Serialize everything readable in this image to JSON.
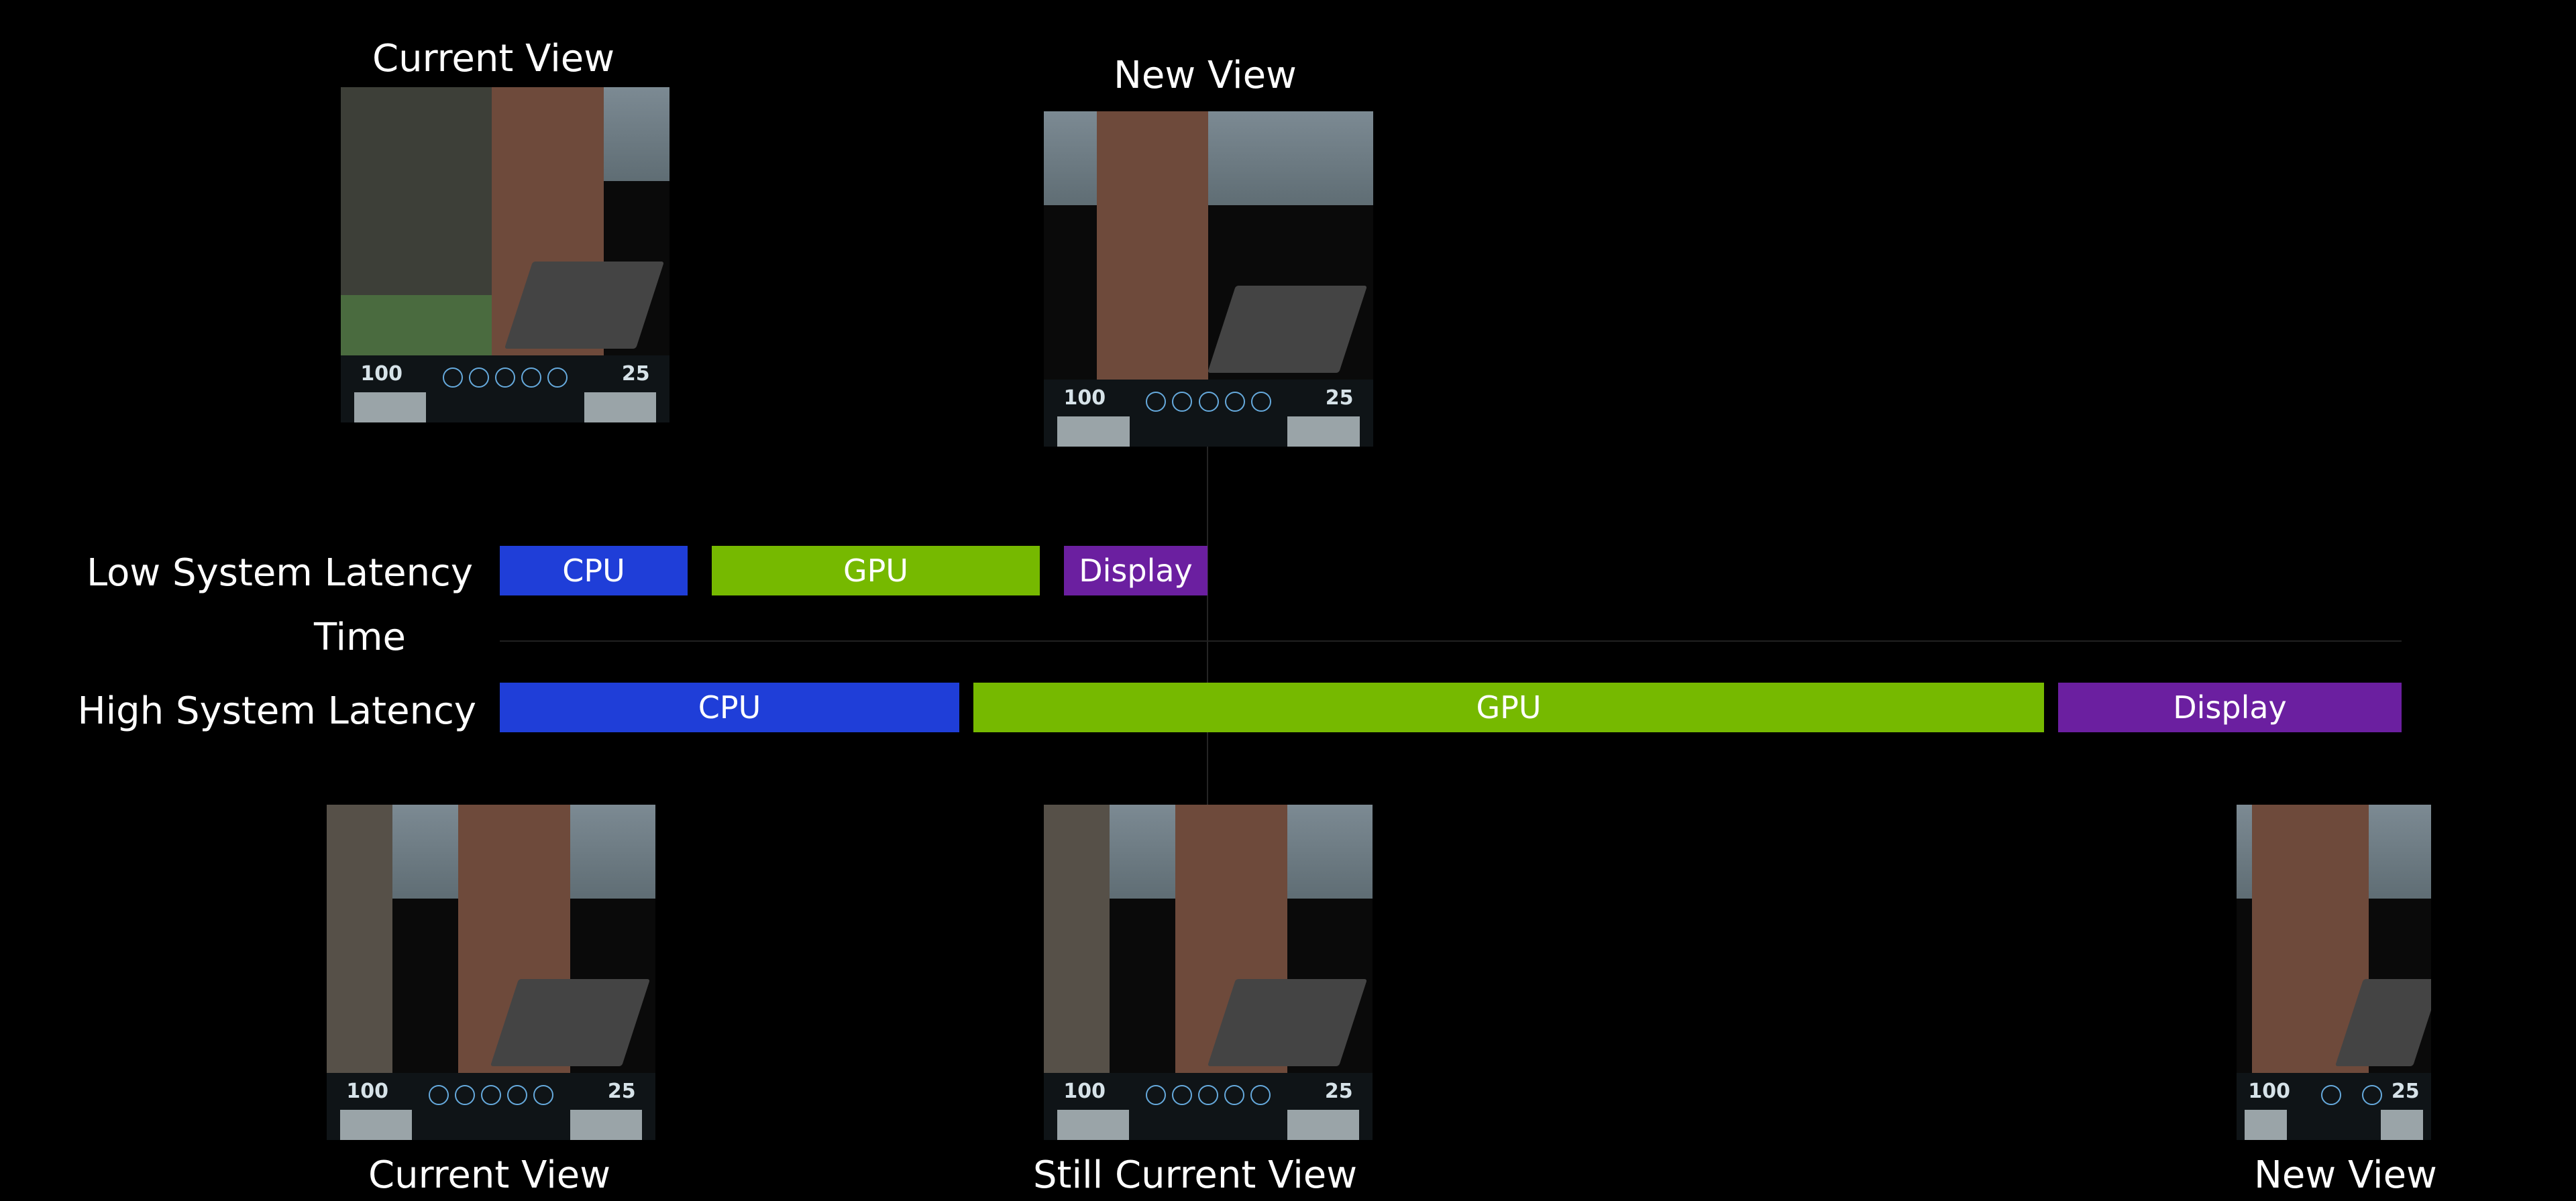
{
  "labels": {
    "currentViewTop": "Current View",
    "newViewTop": "New View",
    "lowLatency": "Low System Latency",
    "highLatency": "High System Latency",
    "time": "Time",
    "currentViewBottom": "Current View",
    "stillCurrentView": "Still Current View",
    "newViewBottom": "New View"
  },
  "stages": {
    "cpu": "CPU",
    "gpu": "GPU",
    "display": "Display"
  },
  "hud": {
    "hp": "100",
    "ammo": "25"
  }
}
